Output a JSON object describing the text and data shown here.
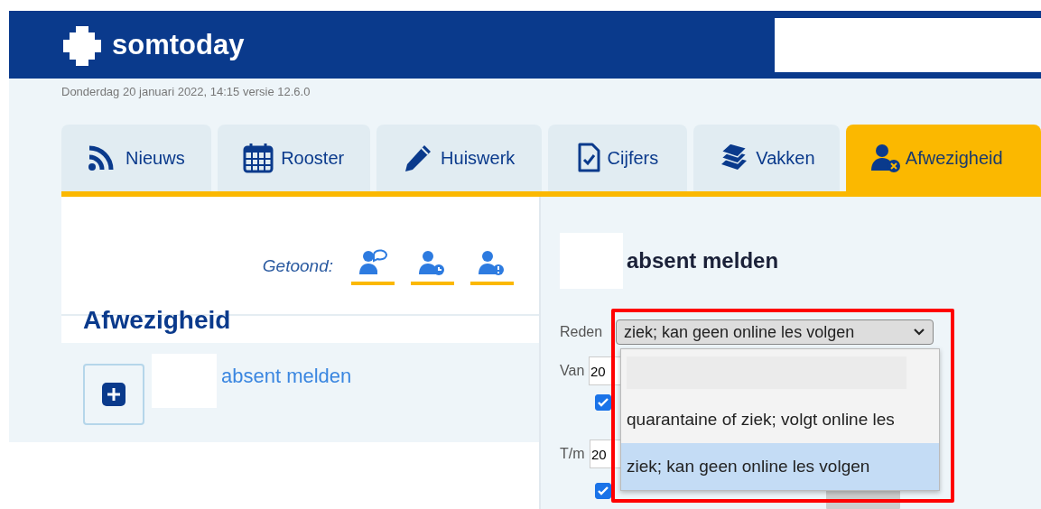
{
  "header": {
    "logo": "somtoday"
  },
  "date_line": "Donderdag 20 januari 2022, 14:15 versie 12.6.0",
  "tabs": [
    {
      "label": "Nieuws",
      "kind": "rss",
      "selected": false
    },
    {
      "label": "Rooster",
      "kind": "calendar",
      "selected": false
    },
    {
      "label": "Huiswerk",
      "kind": "pencil",
      "selected": false
    },
    {
      "label": "Cijfers",
      "kind": "document",
      "selected": false
    },
    {
      "label": "Vakken",
      "kind": "books",
      "selected": false
    },
    {
      "label": "Afwezigheid",
      "kind": "absence",
      "selected": true
    }
  ],
  "left": {
    "filter_label": "Getoond:",
    "filters": [
      {
        "kind": "chat",
        "active": true
      },
      {
        "kind": "clock",
        "active": true
      },
      {
        "kind": "alert",
        "active": true
      }
    ],
    "heading": "Afwezigheid",
    "add_link": "absent melden"
  },
  "form": {
    "title": "absent melden",
    "reason_label": "Reden",
    "reason_value": "ziek; kan geen online les volgen",
    "options": [
      {
        "selected": false
      },
      {
        "label": "quarantaine of ziek; volgt online les",
        "selected": false
      },
      {
        "label": "ziek; kan geen online les volgen",
        "selected": true
      }
    ],
    "from_label": "Van",
    "from_value": "20",
    "from_checked": true,
    "to_label": "T/m",
    "to_value": "20",
    "to_checked": true
  }
}
